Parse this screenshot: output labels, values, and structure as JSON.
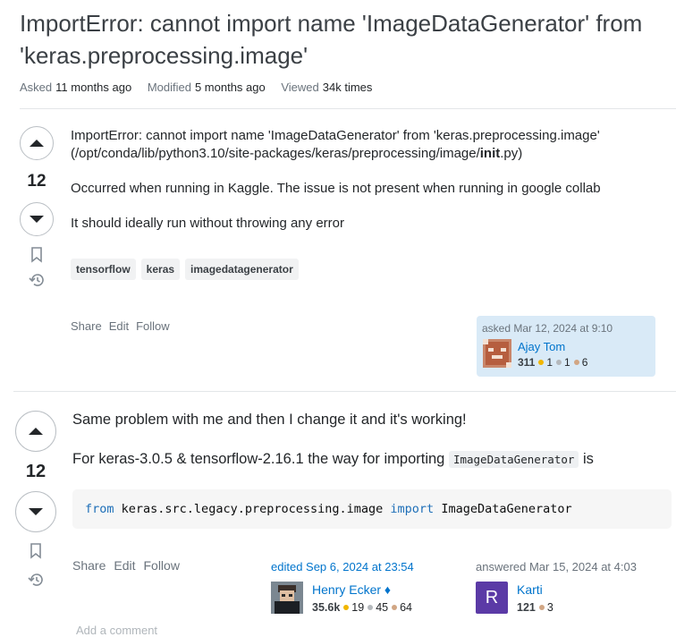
{
  "question": {
    "title": "ImportError: cannot import name 'ImageDataGenerator' from 'keras.preprocessing.image'",
    "asked_label": "Asked",
    "asked_value": "11 months ago",
    "modified_label": "Modified",
    "modified_value": "5 months ago",
    "viewed_label": "Viewed",
    "viewed_value": "34k times",
    "score": "12",
    "body_line1": "ImportError: cannot import name 'ImageDataGenerator' from 'keras.preprocessing.image'",
    "body_line2_pre": "(/opt/conda/lib/python3.10/site-packages/keras/preprocessing/image/",
    "body_line2_bold": "init",
    "body_line2_post": ".py)",
    "body_para2": "Occurred when running in Kaggle. The issue is not present when running in google collab",
    "body_para3": "It should ideally run without throwing any error",
    "tags": [
      "tensorflow",
      "keras",
      "imagedatagenerator"
    ],
    "actions": [
      "Share",
      "Edit",
      "Follow"
    ],
    "owner": {
      "label": "asked Mar 12, 2024 at 9:10",
      "name": "Ajay Tom",
      "rep": "311",
      "gold": "1",
      "silver": "1",
      "bronze": "6"
    }
  },
  "answer": {
    "score": "12",
    "para1": "Same problem with me and then I change it and it's working!",
    "para2_pre": "For keras-3.0.5 & tensorflow-2.16.1 the way for importing",
    "para2_code": "ImageDataGenerator",
    "para2_post": "is",
    "code_from": "from",
    "code_module": "keras.src.legacy.preprocessing.image",
    "code_import": "import",
    "code_name": "ImageDataGenerator",
    "actions": [
      "Share",
      "Edit",
      "Follow"
    ],
    "editor": {
      "label": "edited Sep 6, 2024 at 23:54",
      "name": "Henry Ecker",
      "diamond": "♦",
      "rep": "35.6k",
      "gold": "19",
      "silver": "45",
      "bronze": "64"
    },
    "author": {
      "label": "answered Mar 15, 2024 at 4:03",
      "name": "Karti",
      "initial": "R",
      "rep": "121",
      "bronze": "3"
    },
    "add_comment": "Add a comment"
  },
  "colors": {
    "gold": "#f1b600",
    "silver": "#b4b8bc",
    "bronze": "#d1a684",
    "link": "#0074cc",
    "owner_bg": "#d9eaf7"
  }
}
